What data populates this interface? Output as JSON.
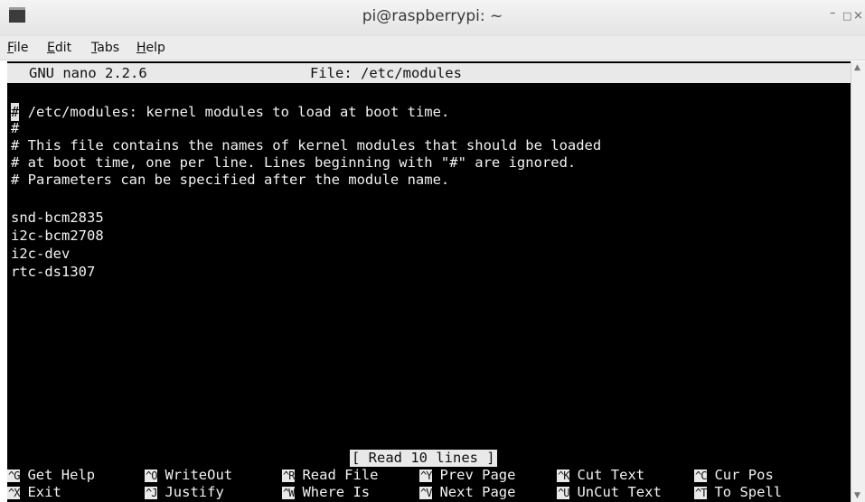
{
  "window": {
    "title": "pi@raspberrypi: ~",
    "minimize_glyph": "–",
    "maximize_glyph": "□",
    "close_glyph": "×"
  },
  "menu": {
    "items": [
      "File",
      "Edit",
      "Tabs",
      "Help"
    ]
  },
  "nano": {
    "version": "GNU nano 2.2.6",
    "file_label": "File: /etc/modules",
    "lines": [
      "/etc/modules: kernel modules to load at boot time.",
      "#",
      "# This file contains the names of kernel modules that should be loaded",
      "# at boot time, one per line. Lines beginning with \"#\" are ignored.",
      "# Parameters can be specified after the module name.",
      "",
      "snd-bcm2835",
      "i2c-bcm2708",
      "i2c-dev",
      "rtc-ds1307"
    ],
    "cursor_char": "#",
    "status_message": "[ Read 10 lines ]",
    "shortcuts_row1": [
      {
        "key": "^G",
        "label": "Get Help"
      },
      {
        "key": "^O",
        "label": "WriteOut"
      },
      {
        "key": "^R",
        "label": "Read File"
      },
      {
        "key": "^Y",
        "label": "Prev Page"
      },
      {
        "key": "^K",
        "label": "Cut Text"
      },
      {
        "key": "^C",
        "label": "Cur Pos"
      }
    ],
    "shortcuts_row2": [
      {
        "key": "^X",
        "label": "Exit"
      },
      {
        "key": "^J",
        "label": "Justify"
      },
      {
        "key": "^W",
        "label": "Where Is"
      },
      {
        "key": "^V",
        "label": "Next Page"
      },
      {
        "key": "^U",
        "label": "UnCut Text"
      },
      {
        "key": "^T",
        "label": "To Spell"
      }
    ]
  },
  "scrollbar": {
    "up_glyph": "▲",
    "down_glyph": "▼"
  },
  "colors": {
    "terminal_bg": "#000000",
    "terminal_fg": "#f2f2f2",
    "header_bg": "#e9e9e9"
  }
}
